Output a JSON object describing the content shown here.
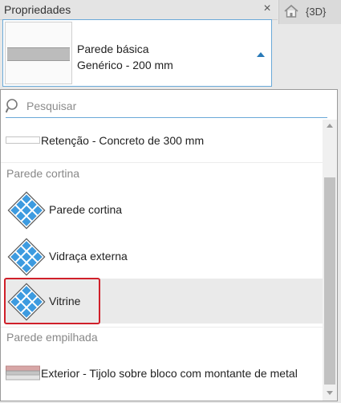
{
  "properties_panel": {
    "title": "Propriedades",
    "close_icon": "×"
  },
  "view_tab": {
    "label": "{3D}"
  },
  "type_selector": {
    "family": "Parede básica",
    "type": "Genérico - 200 mm"
  },
  "search": {
    "placeholder": "Pesquisar",
    "value": ""
  },
  "list": {
    "items": [
      {
        "kind": "item",
        "label": "Retenção - Concreto de 300 mm",
        "icon": "basic-wall-icon"
      },
      {
        "kind": "group",
        "label": "Parede cortina"
      },
      {
        "kind": "item",
        "label": "Parede cortina",
        "icon": "curtain-wall-icon"
      },
      {
        "kind": "item",
        "label": "Vidraça externa",
        "icon": "curtain-wall-icon"
      },
      {
        "kind": "item",
        "label": "Vitrine",
        "icon": "curtain-wall-icon",
        "hovered": true
      },
      {
        "kind": "group",
        "label": "Parede empilhada"
      },
      {
        "kind": "item",
        "label": "Exterior - Tijolo sobre bloco com montante de metal",
        "icon": "stacked-wall-icon"
      }
    ]
  },
  "colors": {
    "accent": "#2a7ab8",
    "selection_outline": "#d0202a",
    "curtain_icon": "#3d9be0"
  }
}
